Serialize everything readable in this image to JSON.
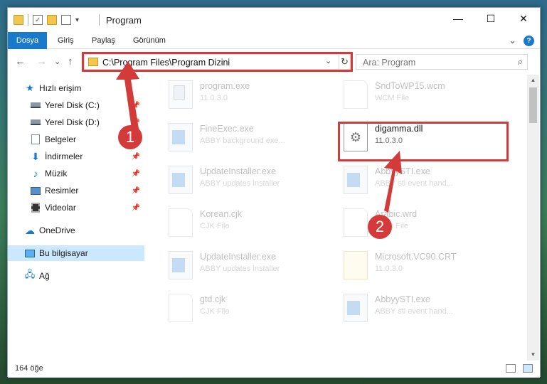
{
  "window": {
    "title": "Program",
    "qat_arrow": "▾"
  },
  "window_buttons": {
    "minimize": "—",
    "maximize": "☐",
    "close": "✕"
  },
  "ribbon": {
    "tabs": [
      "Dosya",
      "Giriş",
      "Paylaş",
      "Görünüm"
    ],
    "expand_icon": "chevron-down-icon",
    "expand_glyph": "⌄",
    "help_glyph": "?"
  },
  "nav": {
    "back": "←",
    "forward": "→",
    "recent": "⌄",
    "up": "↑",
    "address_path": "C:\\Program Files\\Program Dizini",
    "address_dropdown": "⌄",
    "refresh": "↻",
    "search_placeholder": "Ara: Program",
    "search_glyph": "⌕"
  },
  "sidebar": {
    "items": [
      {
        "label": "Hızlı erişim",
        "icon": "star-icon",
        "pinned": false
      },
      {
        "label": "Yerel Disk (C:)",
        "icon": "disk-icon",
        "pinned": true
      },
      {
        "label": "Yerel Disk (D:)",
        "icon": "disk-icon",
        "pinned": true
      },
      {
        "label": "Belgeler",
        "icon": "documents-icon",
        "pinned": true
      },
      {
        "label": "İndirmeler",
        "icon": "downloads-icon",
        "pinned": true
      },
      {
        "label": "Müzik",
        "icon": "music-icon",
        "pinned": true
      },
      {
        "label": "Resimler",
        "icon": "pictures-icon",
        "pinned": true
      },
      {
        "label": "Videolar",
        "icon": "videos-icon",
        "pinned": true
      },
      {
        "label": "OneDrive",
        "icon": "cloud-icon",
        "pinned": false
      },
      {
        "label": "Bu bilgisayar",
        "icon": "computer-icon",
        "pinned": false,
        "selected": true
      },
      {
        "label": "Ağ",
        "icon": "network-icon",
        "pinned": false
      }
    ],
    "pin_glyph": "📌"
  },
  "files": [
    {
      "name": "program.exe",
      "sub": "11.0.3.0",
      "icon": "exe-icon",
      "dim": true
    },
    {
      "name": "SndToWP15.wcm",
      "sub": "WCM File",
      "icon": "blank-file-icon",
      "dim": true
    },
    {
      "name": "FineExec.exe",
      "sub": "ABBY background exe...",
      "icon": "app-icon",
      "dim": true
    },
    {
      "name": "digamma.dll",
      "sub": "11.0.3.0",
      "icon": "dll-icon",
      "dim": false
    },
    {
      "name": "UpdateInstaller.exe",
      "sub": "ABBY updates installer",
      "icon": "app-icon",
      "dim": true
    },
    {
      "name": "AbbyySTI.exe",
      "sub": "ABBY sti event hand...",
      "icon": "app-icon",
      "dim": true
    },
    {
      "name": "Korean.cjk",
      "sub": "CJK File",
      "icon": "blank-file-icon",
      "dim": true
    },
    {
      "name": "Arabic.wrd",
      "sub": "WRD File",
      "icon": "blank-file-icon",
      "dim": true
    },
    {
      "name": "UpdateInstaller.exe",
      "sub": "ABBY updates installer",
      "icon": "app-icon",
      "dim": true
    },
    {
      "name": "Microsoft.VC90.CRT",
      "sub": "11.0.3.0",
      "icon": "crt-icon",
      "dim": true
    },
    {
      "name": "gtd.cjk",
      "sub": "CJK File",
      "icon": "blank-file-icon",
      "dim": true
    },
    {
      "name": "AbbyySTI.exe",
      "sub": "ABBY sti event hand...",
      "icon": "app-icon",
      "dim": true
    }
  ],
  "scroll": {
    "up": "▲",
    "down": "▼"
  },
  "status": {
    "count": "164 öğe"
  },
  "annotations": {
    "step1": "1",
    "step2": "2"
  },
  "colors": {
    "accent": "#1979ca",
    "highlight": "#d33b3b",
    "selected": "#cce8ff"
  }
}
